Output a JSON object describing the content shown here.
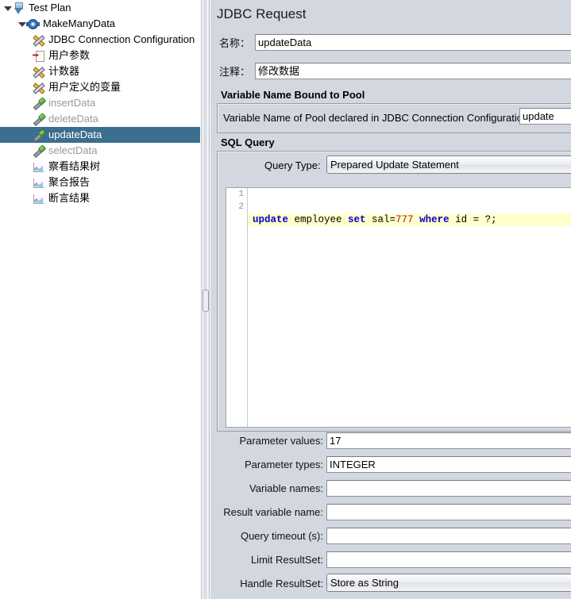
{
  "tree": {
    "nodes": [
      {
        "label": "Test Plan",
        "icon": "testplan-icon",
        "indent": 22,
        "twisty": true,
        "dim": false,
        "selected": false
      },
      {
        "label": "MakeManyData",
        "icon": "thread-group-gear-icon",
        "indent": 40,
        "twisty": true,
        "dim": false,
        "selected": false
      },
      {
        "label": "JDBC Connection Configuration",
        "icon": "config-element-icon",
        "indent": 47,
        "twisty": false,
        "dim": false,
        "selected": false
      },
      {
        "label": "用户参数",
        "icon": "user-parameters-icon",
        "indent": 47,
        "twisty": false,
        "dim": false,
        "selected": false
      },
      {
        "label": "计数器",
        "icon": "config-element-icon",
        "indent": 47,
        "twisty": false,
        "dim": false,
        "selected": false
      },
      {
        "label": "用户定义的变量",
        "icon": "config-element-icon",
        "indent": 47,
        "twisty": false,
        "dim": false,
        "selected": false
      },
      {
        "label": "insertData",
        "icon": "jdbc-sampler-icon",
        "indent": 47,
        "twisty": false,
        "dim": true,
        "selected": false
      },
      {
        "label": "deleteData",
        "icon": "jdbc-sampler-icon",
        "indent": 47,
        "twisty": false,
        "dim": true,
        "selected": false
      },
      {
        "label": "updateData",
        "icon": "jdbc-sampler-icon",
        "indent": 47,
        "twisty": false,
        "dim": false,
        "selected": true
      },
      {
        "label": "selectData",
        "icon": "jdbc-sampler-icon",
        "indent": 47,
        "twisty": false,
        "dim": true,
        "selected": false
      },
      {
        "label": "察看结果树",
        "icon": "listener-icon",
        "indent": 47,
        "twisty": false,
        "dim": false,
        "selected": false
      },
      {
        "label": "聚合报告",
        "icon": "listener-icon",
        "indent": 47,
        "twisty": false,
        "dim": false,
        "selected": false
      },
      {
        "label": "断言结果",
        "icon": "listener-icon",
        "indent": 47,
        "twisty": false,
        "dim": false,
        "selected": false
      }
    ],
    "selection_color": "#3b6e8f"
  },
  "request": {
    "title": "JDBC Request",
    "name_label": "名称：",
    "name_value": "updateData",
    "comment_label": "注释：",
    "comment_value": "修改数据"
  },
  "pool": {
    "panel_title": "Variable Name Bound to Pool",
    "field_label": "Variable Name of Pool declared in JDBC Connection Configuration:",
    "field_value": "update"
  },
  "sql": {
    "panel_title": "SQL Query",
    "query_type_label": "Query Type:",
    "query_type_value": "Prepared Update Statement",
    "line_numbers": [
      "1",
      "2"
    ],
    "code_line_1": [
      {
        "t": "update",
        "c": "kw"
      },
      {
        "t": " employee ",
        "c": ""
      },
      {
        "t": "set",
        "c": "kw"
      },
      {
        "t": " sal=",
        "c": ""
      },
      {
        "t": "777",
        "c": "num"
      },
      {
        "t": " ",
        "c": ""
      },
      {
        "t": "where",
        "c": "kw"
      },
      {
        "t": " id = ?;",
        "c": ""
      }
    ],
    "current_line_highlight": "#ffffcc",
    "keyword_color": "#0000d0",
    "number_color": "#a31515"
  },
  "params": {
    "rows": [
      {
        "label": "Parameter values:",
        "value": "17",
        "type": "text"
      },
      {
        "label": "Parameter types:",
        "value": "INTEGER",
        "type": "text"
      },
      {
        "label": "Variable names:",
        "value": "",
        "type": "text"
      },
      {
        "label": "Result variable name:",
        "value": "",
        "type": "text"
      },
      {
        "label": "Query timeout (s):",
        "value": "",
        "type": "text"
      },
      {
        "label": "Limit ResultSet:",
        "value": "",
        "type": "text"
      },
      {
        "label": "Handle ResultSet:",
        "value": "Store as String",
        "type": "combo"
      }
    ]
  }
}
